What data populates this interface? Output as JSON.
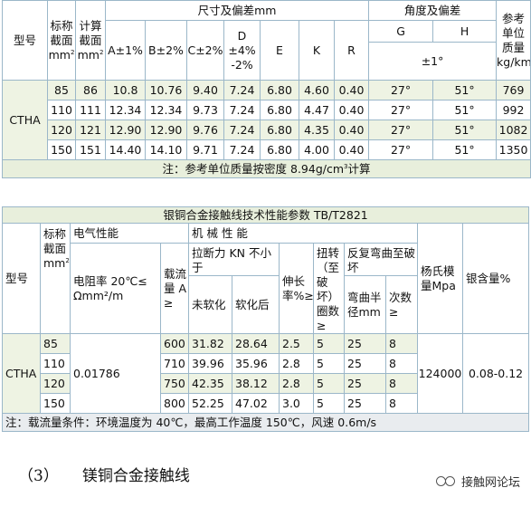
{
  "table1": {
    "h_model": "型号",
    "h_nominal": "标称截面",
    "h_calc": "计算截面",
    "area_unit": "mm",
    "h_dim": "尺寸及偏差mm",
    "h_angle": "角度及偏差",
    "h_ref": "参考单位质量kg/km",
    "h_A": "A±1%",
    "h_B": "B±2%",
    "h_C": "C±2%",
    "h_D": "D ±4% -2%",
    "h_E": "E",
    "h_K": "K",
    "h_R": "R",
    "h_G": "G",
    "h_H": "H",
    "h_angle_tol": "±1°",
    "model": "CTHA",
    "rows": [
      [
        "85",
        "86",
        "10.8",
        "10.76",
        "9.40",
        "7.24",
        "6.80",
        "4.60",
        "0.40",
        "27°",
        "51°",
        "769"
      ],
      [
        "110",
        "111",
        "12.34",
        "12.34",
        "9.73",
        "7.24",
        "6.80",
        "4.47",
        "0.40",
        "27°",
        "51°",
        "992"
      ],
      [
        "120",
        "121",
        "12.90",
        "12.90",
        "9.76",
        "7.24",
        "6.80",
        "4.35",
        "0.40",
        "27°",
        "51°",
        "1082"
      ],
      [
        "150",
        "151",
        "14.40",
        "14.10",
        "9.71",
        "7.24",
        "6.80",
        "4.00",
        "0.40",
        "27°",
        "51°",
        "1350"
      ]
    ],
    "note_prefix": "注：参考单位质量按密度 8.94g/cm",
    "note_suffix": "计算",
    "note_sup": "3"
  },
  "table2": {
    "title": "银铜合金接触线技术性能参数 TB/T2821",
    "h_model": "型号",
    "h_nominal": "标称截面",
    "area_unit": "mm",
    "h_elec": "电气性能",
    "h_resist": "电阻率 20℃≤ Ωmm²/m",
    "h_current": "载流量 A ≥",
    "h_mech": "机 械 性 能",
    "h_tensile": "拉断力 KN 不小于",
    "h_unsoft": "未软化",
    "h_soft": "软化后",
    "h_elong": "伸长率%≥",
    "h_twist": "扭转（至破坏）圈数≥",
    "h_bend": "反复弯曲至破坏",
    "h_bend_r": "弯曲半径mm",
    "h_bend_n": "次数≥",
    "h_modulus": "杨氏模量Mpa",
    "h_silver": "银含量%",
    "model": "CTHA",
    "resistivity": "0.01786",
    "modulus": "124000",
    "silver": "0.08-0.12",
    "rows": [
      [
        "85",
        "600",
        "31.82",
        "28.64",
        "2.5",
        "5",
        "25",
        "8"
      ],
      [
        "110",
        "710",
        "39.96",
        "35.96",
        "2.8",
        "5",
        "25",
        "8"
      ],
      [
        "120",
        "750",
        "42.35",
        "38.12",
        "2.8",
        "5",
        "25",
        "8"
      ],
      [
        "150",
        "800",
        "52.25",
        "47.02",
        "3.0",
        "5",
        "25",
        "8"
      ]
    ],
    "note": "注：载流量条件：环境温度为 40℃，最高工作温度 150℃，风速 0.6m/s"
  },
  "section": {
    "number": "（3）",
    "title": "镁铜合金接触线"
  },
  "watermark": "接触网论坛"
}
